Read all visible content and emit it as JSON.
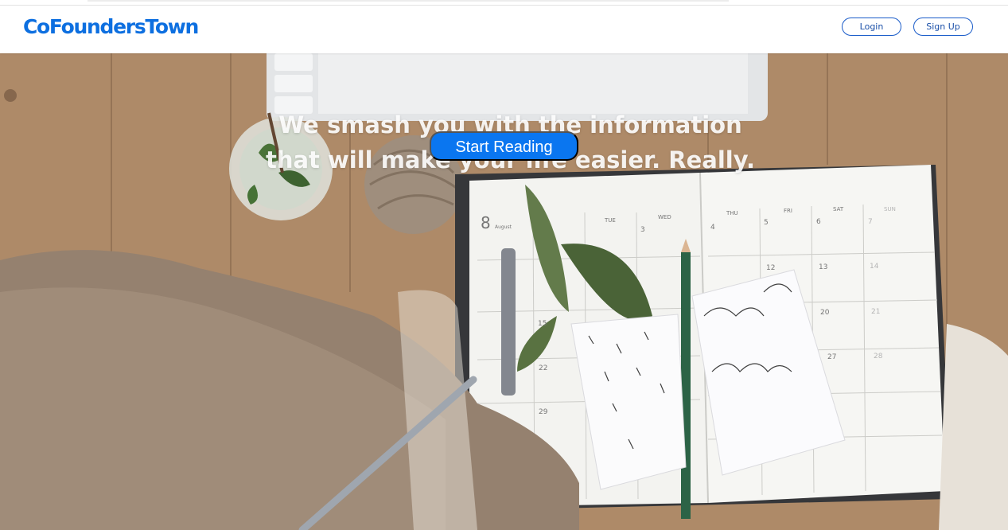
{
  "brand": {
    "name": "CoFoundersTown",
    "color": "#0d6fe0"
  },
  "nav": {
    "login_label": "Login",
    "signup_label": "Sign Up"
  },
  "hero": {
    "headline_line1": "We smash you with the information",
    "headline_line2": "that will make your life easier. Really.",
    "cta_label": "Start Reading",
    "cta_color": "#0a76f0"
  },
  "calendar": {
    "day_number": "8",
    "month": "August",
    "weekdays": [
      "TUE",
      "WED",
      "THU",
      "FRI",
      "SAT",
      "SUN"
    ],
    "dates": [
      "3",
      "4",
      "5",
      "6",
      "7",
      "12",
      "13",
      "14",
      "15",
      "20",
      "21",
      "22",
      "27",
      "28",
      "29"
    ]
  }
}
